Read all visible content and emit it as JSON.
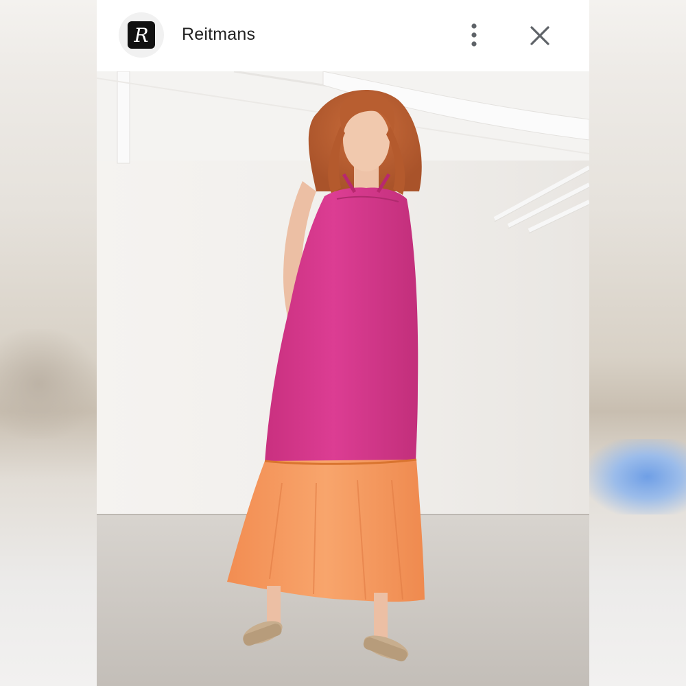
{
  "header": {
    "brand_name": "Reitmans",
    "logo_letter": "R"
  },
  "icons": {
    "more": "more-vertical-icon",
    "close": "close-icon"
  },
  "colors": {
    "dress_top": "#d93a8f",
    "dress_hem": "#f59a60",
    "wall": "#f3f1ee",
    "floor": "#c9c4be"
  }
}
